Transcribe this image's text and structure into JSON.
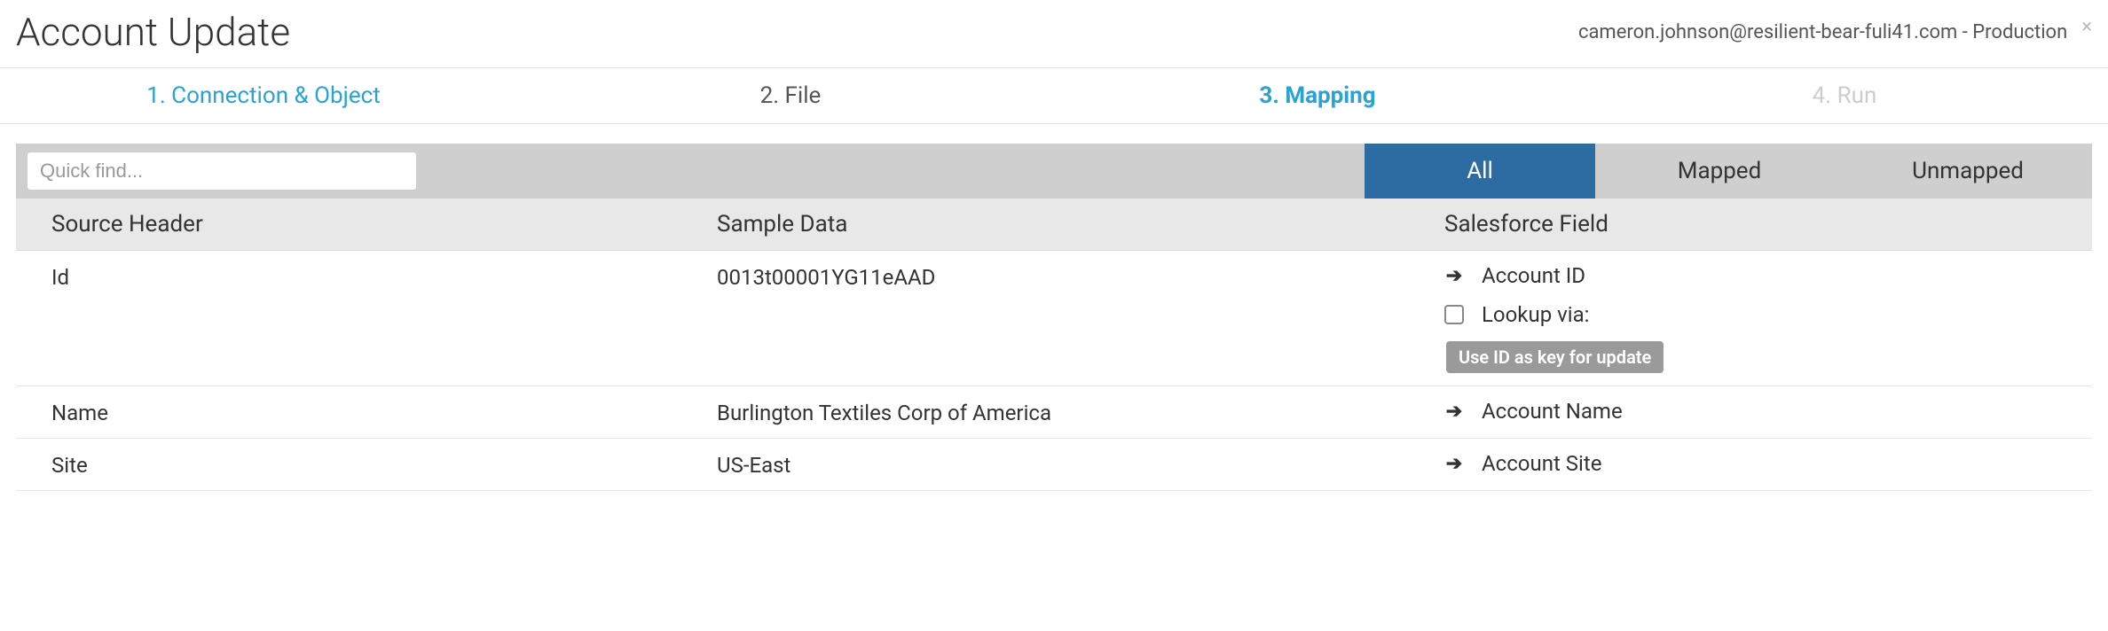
{
  "header": {
    "title": "Account Update",
    "user": "cameron.johnson@resilient-bear-fuli41.com - Production"
  },
  "wizard": {
    "steps": [
      {
        "label": "1. Connection & Object",
        "state": "link"
      },
      {
        "label": "2. File",
        "state": "plain"
      },
      {
        "label": "3. Mapping",
        "state": "active"
      },
      {
        "label": "4. Run",
        "state": "disabled"
      }
    ]
  },
  "toolbar": {
    "search_placeholder": "Quick find...",
    "filters": {
      "all": "All",
      "mapped": "Mapped",
      "unmapped": "Unmapped"
    },
    "active_filter": "all"
  },
  "table": {
    "columns": {
      "source": "Source Header",
      "sample": "Sample Data",
      "sf": "Salesforce Field"
    },
    "rows": [
      {
        "source": "Id",
        "sample": "0013t00001YG11eAAD",
        "sf_field": "Account ID",
        "lookup_label": "Lookup via:",
        "badge": "Use ID as key for update",
        "has_extra": true
      },
      {
        "source": "Name",
        "sample": "Burlington Textiles Corp of America",
        "sf_field": "Account Name",
        "has_extra": false
      },
      {
        "source": "Site",
        "sample": "US-East",
        "sf_field": "Account Site",
        "has_extra": false
      }
    ]
  }
}
